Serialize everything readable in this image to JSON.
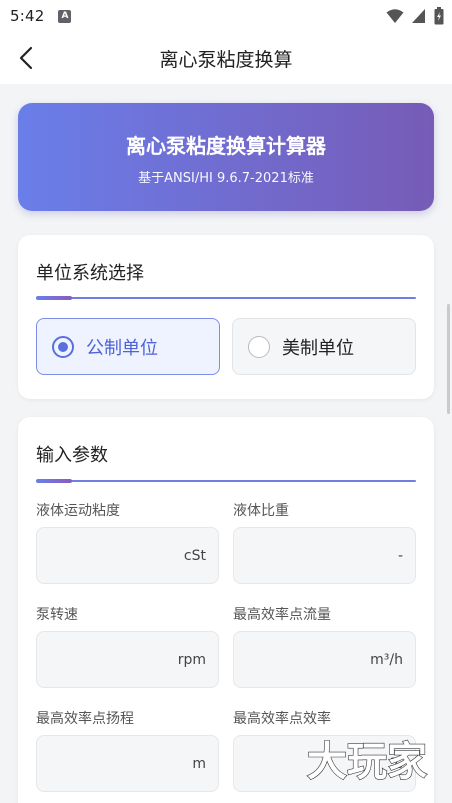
{
  "status_bar": {
    "time": "5:42",
    "app_icon_letter": "A"
  },
  "header": {
    "title": "离心泵粘度换算"
  },
  "banner": {
    "title": "离心泵粘度换算计算器",
    "subtitle": "基于ANSI/HI 9.6.7-2021标准"
  },
  "unit_section": {
    "title": "单位系统选择",
    "options": [
      {
        "label": "公制单位",
        "selected": true
      },
      {
        "label": "美制单位",
        "selected": false
      }
    ]
  },
  "input_section": {
    "title": "输入参数",
    "fields": [
      {
        "label": "液体运动粘度",
        "value": "",
        "unit": "cSt"
      },
      {
        "label": "液体比重",
        "value": "",
        "unit": "-"
      },
      {
        "label": "泵转速",
        "value": "",
        "unit": "rpm"
      },
      {
        "label": "最高效率点流量",
        "value": "",
        "unit": "m³/h"
      },
      {
        "label": "最高效率点扬程",
        "value": "",
        "unit": "m"
      },
      {
        "label": "最高效率点效率",
        "value": "",
        "unit": "%"
      }
    ]
  },
  "watermark": {
    "text": "大玩家"
  },
  "colors": {
    "accent": "#5b6fdc",
    "banner_start": "#6a7ee9",
    "banner_end": "#775bb7"
  },
  "icons": [
    "back-arrow-icon",
    "wifi-icon",
    "signal-icon",
    "battery-icon",
    "radio-selected-icon",
    "radio-unselected-icon"
  ]
}
